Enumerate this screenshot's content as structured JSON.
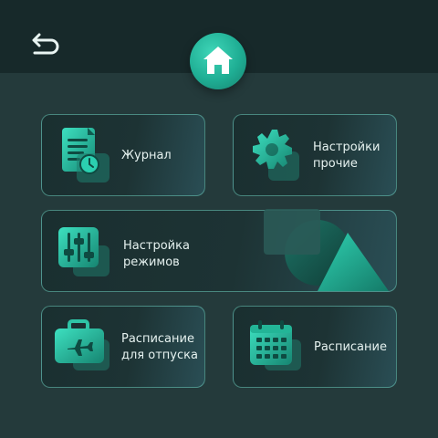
{
  "header": {
    "back_icon": "back-arrow-icon",
    "home_icon": "home-icon"
  },
  "menu": {
    "journal": {
      "label": "Журнал",
      "icon": "journal-clock-icon"
    },
    "settings_other": {
      "label": "Настройки\nпрочие",
      "icon": "gear-icon"
    },
    "mode_settings": {
      "label": "Настройка\nрежимов",
      "icon": "sliders-icon"
    },
    "vacation_schedule": {
      "label": "Расписание\nдля отпуска",
      "icon": "suitcase-plane-icon"
    },
    "schedule": {
      "label": "Расписание",
      "icon": "calendar-icon"
    }
  },
  "colors": {
    "accent": "#2ec4a6",
    "background": "#243a3b",
    "topbar": "#17292a",
    "card_border": "#6ecdbe"
  }
}
